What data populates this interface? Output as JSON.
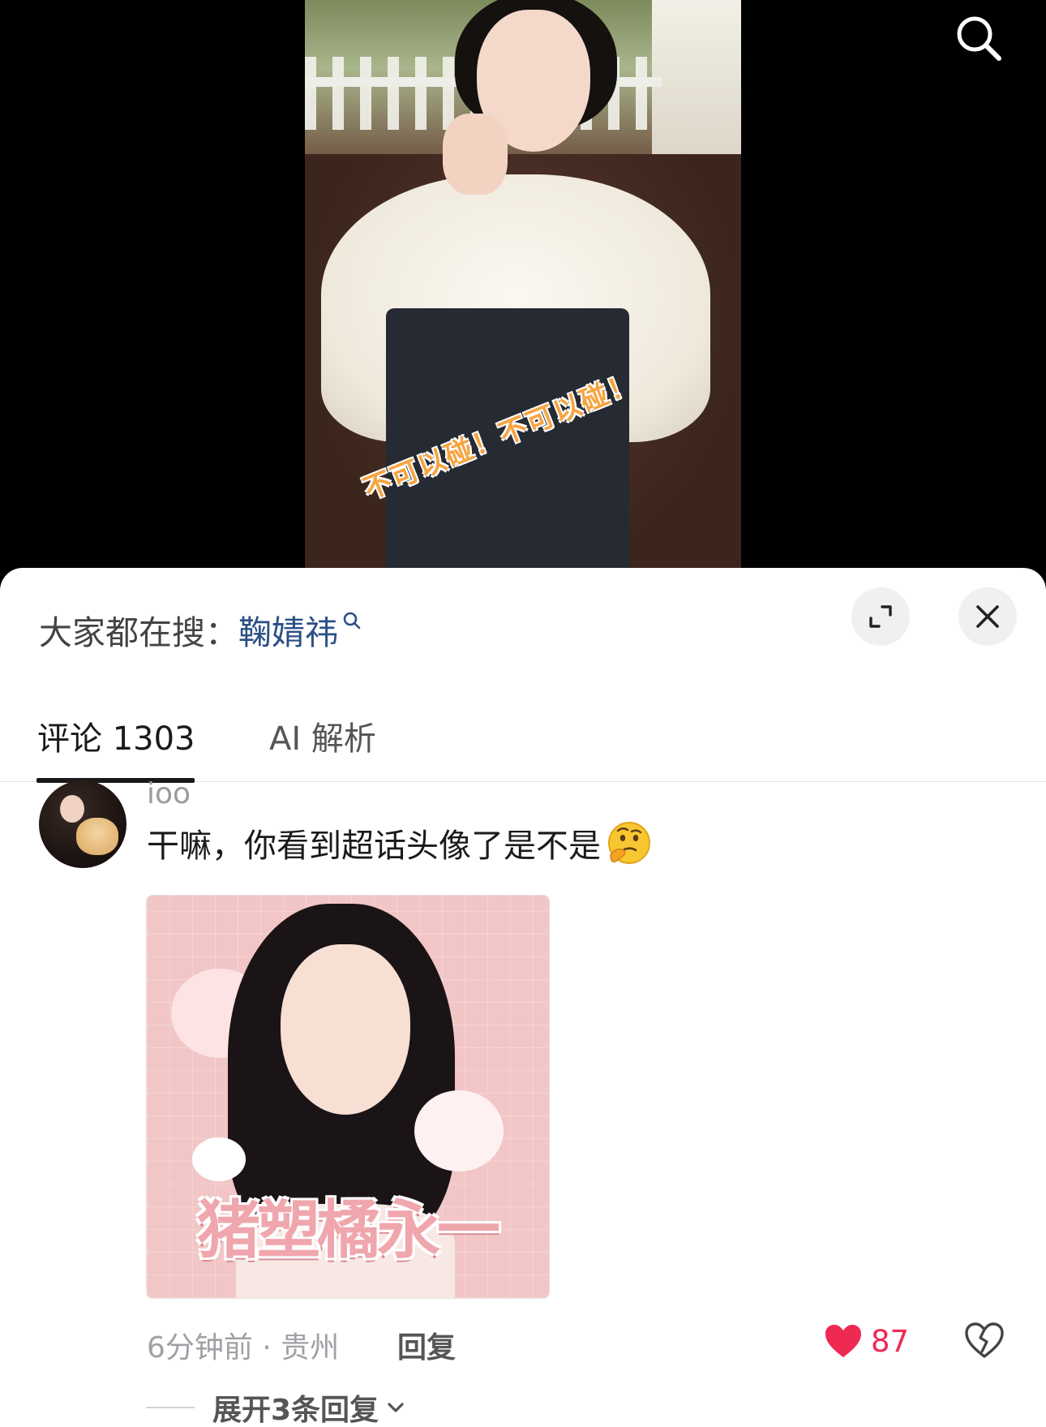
{
  "video": {
    "overlay_text": "不可以碰！不可以碰！"
  },
  "top_bar": {
    "search_icon": "search-icon"
  },
  "sheet": {
    "trending": {
      "prefix": "大家都在搜：",
      "term": "鞠婧祎"
    },
    "buttons": {
      "expand_icon": "expand-icon",
      "close_icon": "close-icon"
    },
    "tabs": [
      {
        "label": "评论 1303",
        "active": true
      },
      {
        "label": "AI 解析",
        "active": false
      }
    ]
  },
  "comment": {
    "username": "ioo",
    "text": "干嘛，你看到超话头像了是不是",
    "emoji": "thinking-face",
    "image_caption": "猪塑橘永一",
    "time_location": "6分钟前 · 贵州",
    "reply_label": "回复",
    "like_count": "87",
    "expand_label": "展开3条回复"
  },
  "colors": {
    "accent_link": "#2b4f86",
    "like_red": "#ee2a52",
    "tab_underline": "#1a1a1a"
  }
}
